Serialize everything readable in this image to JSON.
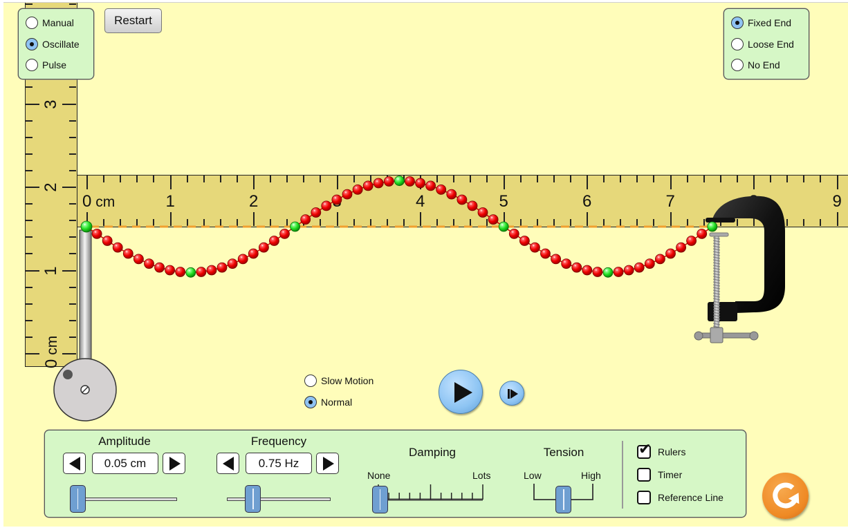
{
  "mode_panel": {
    "options": [
      {
        "label": "Manual",
        "selected": false
      },
      {
        "label": "Oscillate",
        "selected": true
      },
      {
        "label": "Pulse",
        "selected": false
      }
    ]
  },
  "restart_button": {
    "label": "Restart"
  },
  "end_panel": {
    "options": [
      {
        "label": "Fixed End",
        "selected": true
      },
      {
        "label": "Loose End",
        "selected": false
      },
      {
        "label": "No End",
        "selected": false
      }
    ]
  },
  "horizontal_ruler": {
    "unit": "cm",
    "labels": [
      "0 cm",
      "1",
      "2",
      "3",
      "4",
      "5",
      "6",
      "7",
      "8",
      "9"
    ]
  },
  "vertical_ruler": {
    "labels": [
      "0 cm",
      "1",
      "2",
      "3"
    ]
  },
  "wave": {
    "bead_count": 61,
    "highlight_every": 10,
    "wavelength_beads": 40,
    "amplitude_cm": 0.55,
    "phase": "starting at equilibrium, moving down first",
    "bead_color": "#ff0000",
    "highlight_bead_color": "#22e022",
    "reference_line_color": "#f0a030"
  },
  "speed": {
    "options": [
      {
        "label": "Slow Motion",
        "selected": false
      },
      {
        "label": "Normal",
        "selected": true
      }
    ]
  },
  "playback": {
    "play_icon": "play-icon",
    "step_icon": "step-forward-icon",
    "state": "paused"
  },
  "controls": {
    "amplitude": {
      "title": "Amplitude",
      "value": "0.05 cm",
      "slider_fraction": 0.0
    },
    "frequency": {
      "title": "Frequency",
      "value": "0.75 Hz",
      "slider_fraction": 0.25
    },
    "damping": {
      "title": "Damping",
      "min_label": "None",
      "max_label": "Lots",
      "slider_fraction": 0.0
    },
    "tension": {
      "title": "Tension",
      "min_label": "Low",
      "max_label": "High",
      "slider_fraction": 0.5
    }
  },
  "checkboxes": [
    {
      "label": "Rulers",
      "checked": true
    },
    {
      "label": "Timer",
      "checked": false
    },
    {
      "label": "Reference Line",
      "checked": false
    }
  ],
  "reset_all": {
    "icon": "reset-icon"
  },
  "colors": {
    "background": "#FFFDBA",
    "panel": "#D6F7C6",
    "ruler": "#E6D87A",
    "button_blue": "#8dc4f3",
    "reset_orange": "#ef8a25"
  }
}
